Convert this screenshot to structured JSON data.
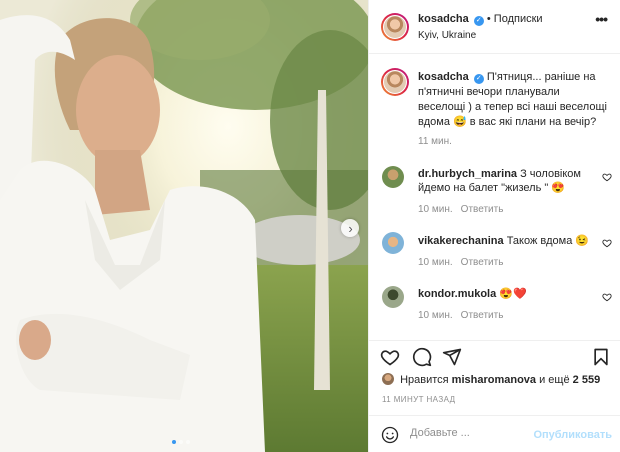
{
  "post": {
    "username": "kosadcha",
    "follow_label": "• Подписки",
    "location": "Kyiv, Ukraine",
    "caption": "П'ятниця... раніше на п'ятничні вечори планували веселощі ) а тепер всі наші веселощі вдома 😅 в вас які плани на вечір?",
    "caption_time": "11 мин.",
    "image_dots": 3,
    "active_dot": 0
  },
  "comments": [
    {
      "username": "dr.hurbych_marina",
      "text": "З чоловіком йдемо на балет \"жизель \" 😍",
      "time": "10 мин.",
      "reply": "Ответить"
    },
    {
      "username": "vikakerechanina",
      "text": "Також вдома 😉",
      "time": "10 мин.",
      "reply": "Ответить"
    },
    {
      "username": "kondor.mukola",
      "text": "😍❤️",
      "time": "10 мин.",
      "reply": "Ответить"
    }
  ],
  "likes": {
    "prefix": "Нравится",
    "user": "misharomanova",
    "suffix": "и ещё",
    "count": "2 559"
  },
  "posted_ago": "11 МИНУТ НАЗАД",
  "add_comment": {
    "placeholder": "Добавьте ...",
    "publish_label": "Опубликовать"
  },
  "icons": {
    "more": "more-icon",
    "next": "chevron-right-icon",
    "like": "heart-icon",
    "comment": "comment-icon",
    "share": "send-icon",
    "save": "bookmark-icon",
    "emoji": "emoji-icon"
  },
  "colors": {
    "accent": "#3897f0",
    "muted": "#8e8e8e",
    "publish_disabled": "#b2dffc",
    "text": "#262626"
  }
}
